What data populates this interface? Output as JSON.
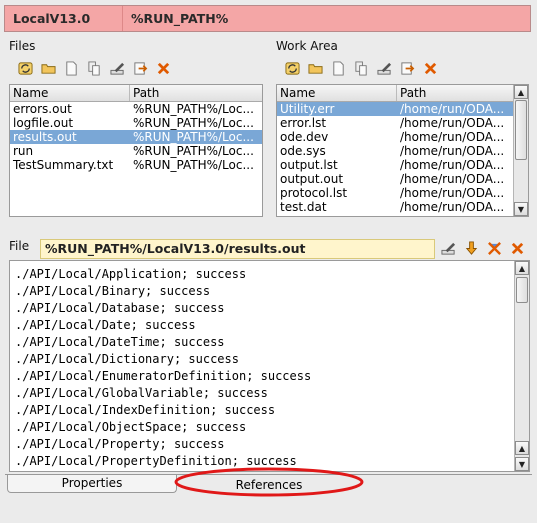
{
  "banner": {
    "name": "LocalV13.0",
    "path": "%RUN_PATH%"
  },
  "files": {
    "label": "Files",
    "columns": [
      "Name",
      "Path"
    ],
    "rows": [
      {
        "name": "errors.out",
        "path": "%RUN_PATH%/Loc...",
        "selected": false
      },
      {
        "name": "logfile.out",
        "path": "%RUN_PATH%/Loc...",
        "selected": false
      },
      {
        "name": "results.out",
        "path": "%RUN_PATH%/Loc...",
        "selected": true
      },
      {
        "name": "run",
        "path": "%RUN_PATH%/Loc...",
        "selected": false
      },
      {
        "name": "TestSummary.txt",
        "path": "%RUN_PATH%/Loc...",
        "selected": false
      }
    ]
  },
  "workarea": {
    "label": "Work Area",
    "columns": [
      "Name",
      "Path"
    ],
    "rows": [
      {
        "name": "Utility.err",
        "path": "/home/run/ODA...",
        "selected": true
      },
      {
        "name": "error.lst",
        "path": "/home/run/ODA...",
        "selected": false
      },
      {
        "name": "ode.dev",
        "path": "/home/run/ODA...",
        "selected": false
      },
      {
        "name": "ode.sys",
        "path": "/home/run/ODA...",
        "selected": false
      },
      {
        "name": "output.lst",
        "path": "/home/run/ODA...",
        "selected": false
      },
      {
        "name": "output.out",
        "path": "/home/run/ODA...",
        "selected": false
      },
      {
        "name": "protocol.lst",
        "path": "/home/run/ODA...",
        "selected": false
      },
      {
        "name": "test.dat",
        "path": "/home/run/ODA...",
        "selected": false
      }
    ]
  },
  "file": {
    "label": "File",
    "path": "%RUN_PATH%/LocalV13.0/results.out",
    "lines": [
      "./API/Local/Application; success",
      "./API/Local/Binary; success",
      "./API/Local/Database; success",
      "./API/Local/Date; success",
      "./API/Local/DateTime; success",
      "./API/Local/Dictionary; success",
      "./API/Local/EnumeratorDefinition; success",
      "./API/Local/GlobalVariable; success",
      "./API/Local/IndexDefinition; success",
      "./API/Local/ObjectSpace; success",
      "./API/Local/Property; success",
      "./API/Local/PropertyDefinition; success"
    ]
  },
  "tabs": {
    "properties": "Properties",
    "references": "References"
  },
  "toolbar_icons": [
    "refresh-icon",
    "open-folder-icon",
    "new-document-icon",
    "copy-icon",
    "edit-icon",
    "export-icon",
    "delete-icon"
  ],
  "colors": {
    "banner": "#f4a6a6",
    "selection": "#7aa7d6",
    "file_field": "#fff5cc",
    "highlight_ellipse": "#e01818"
  }
}
